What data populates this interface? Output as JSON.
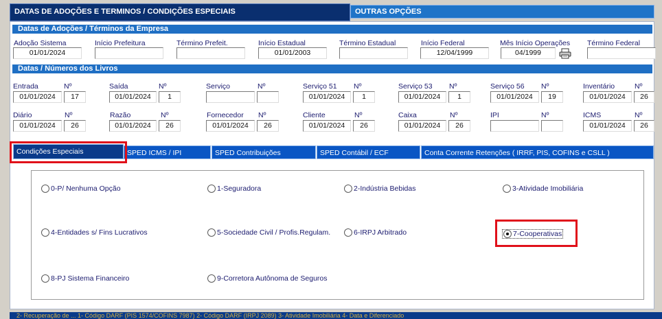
{
  "top_tabs": {
    "active": "DATAS DE ADOÇÕES E TERMINOS / CONDIÇÕES ESPECIAIS",
    "other": "OUTRAS OPÇÕES"
  },
  "adocoes": {
    "section_title": "Datas de Adoções / Términos da Empresa",
    "fields": [
      {
        "label": "Adoção Sistema",
        "value": "01/01/2024"
      },
      {
        "label": "Início Prefeitura",
        "value": ""
      },
      {
        "label": "Término Prefeit.",
        "value": ""
      },
      {
        "label": "Início Estadual",
        "value": "01/01/2003"
      },
      {
        "label": "Término Estadual",
        "value": ""
      },
      {
        "label": "Início Federal",
        "value": "12/04/1999"
      },
      {
        "label": "Mês Início Operações",
        "value": "04/1999"
      },
      {
        "label": "Término Federal",
        "value": ""
      }
    ]
  },
  "livros": {
    "section_title": "Datas / Números dos Livros",
    "num_label": "Nº",
    "row1": [
      {
        "label": "Entrada",
        "date": "01/01/2024",
        "num": "17"
      },
      {
        "label": "Saída",
        "date": "01/01/2024",
        "num": "1"
      },
      {
        "label": "Serviço",
        "date": "",
        "num": ""
      },
      {
        "label": "Serviço 51",
        "date": "01/01/2024",
        "num": "1"
      },
      {
        "label": "Serviço 53",
        "date": "01/01/2024",
        "num": "1"
      },
      {
        "label": "Serviço 56",
        "date": "01/01/2024",
        "num": "19"
      },
      {
        "label": "Inventário",
        "date": "01/01/2024",
        "num": "26"
      }
    ],
    "row2": [
      {
        "label": "Diário",
        "date": "01/01/2024",
        "num": "26"
      },
      {
        "label": "Razão",
        "date": "01/01/2024",
        "num": "26"
      },
      {
        "label": "Fornecedor",
        "date": "01/01/2024",
        "num": "26"
      },
      {
        "label": "Cliente",
        "date": "01/01/2024",
        "num": "26"
      },
      {
        "label": "Caixa",
        "date": "01/01/2024",
        "num": "26"
      },
      {
        "label": "IPI",
        "date": "",
        "num": ""
      },
      {
        "label": "ICMS",
        "date": "01/01/2024",
        "num": "26"
      }
    ]
  },
  "sub_tabs": [
    "Condições Especiais",
    "SPED ICMS / IPI",
    "SPED Contribuições",
    "SPED Contábil / ECF",
    "Conta Corrente Retenções ( IRRF, PIS, COFINS e CSLL )"
  ],
  "options": [
    "0-P/ Nenhuma Opção",
    "1-Seguradora",
    "2-Indústria Bebidas",
    "3-Atividade Imobiliária",
    "4-Entidades s/ Fins Lucrativos",
    "5-Sociedade Civil / Profis.Regulam.",
    "6-IRPJ Arbitrado",
    "7-Cooperativas",
    "8-PJ Sistema Financeiro",
    "9-Corretora Autônoma de Seguros"
  ],
  "selected_option": "7-Cooperativas",
  "bottom_strip": "2- Recuperação de ... 1- Código DARF (PIS 1574/COFINS 7987) 2- Código DARF (IRPJ 2089) 3- Atividade Imobiliária 4- Data e Diferenciado"
}
